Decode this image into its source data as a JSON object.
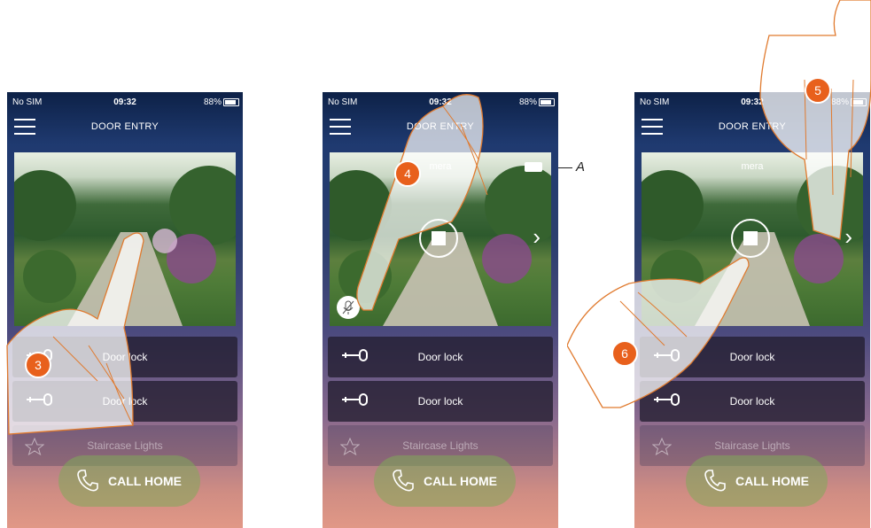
{
  "status_bar": {
    "carrier": "No SIM",
    "time": "09:32",
    "battery": "88%"
  },
  "screens": [
    {
      "title": "DOOR ENTRY",
      "camera_label": "",
      "step": "3"
    },
    {
      "title": "DOOR ENTRY",
      "camera_label": "mera",
      "step": "4"
    },
    {
      "title": "DOOR ENTRY",
      "camera_label": "mera",
      "step_top": "5",
      "step": "6"
    }
  ],
  "rows": {
    "door_lock_1": "Door lock",
    "door_lock_2": "Door lock",
    "staircase": "Staircase Lights"
  },
  "call_button": "CALL HOME",
  "callout_a": "A",
  "colors": {
    "badge": "#e8601c",
    "hand_outline": "#e07a2e"
  }
}
